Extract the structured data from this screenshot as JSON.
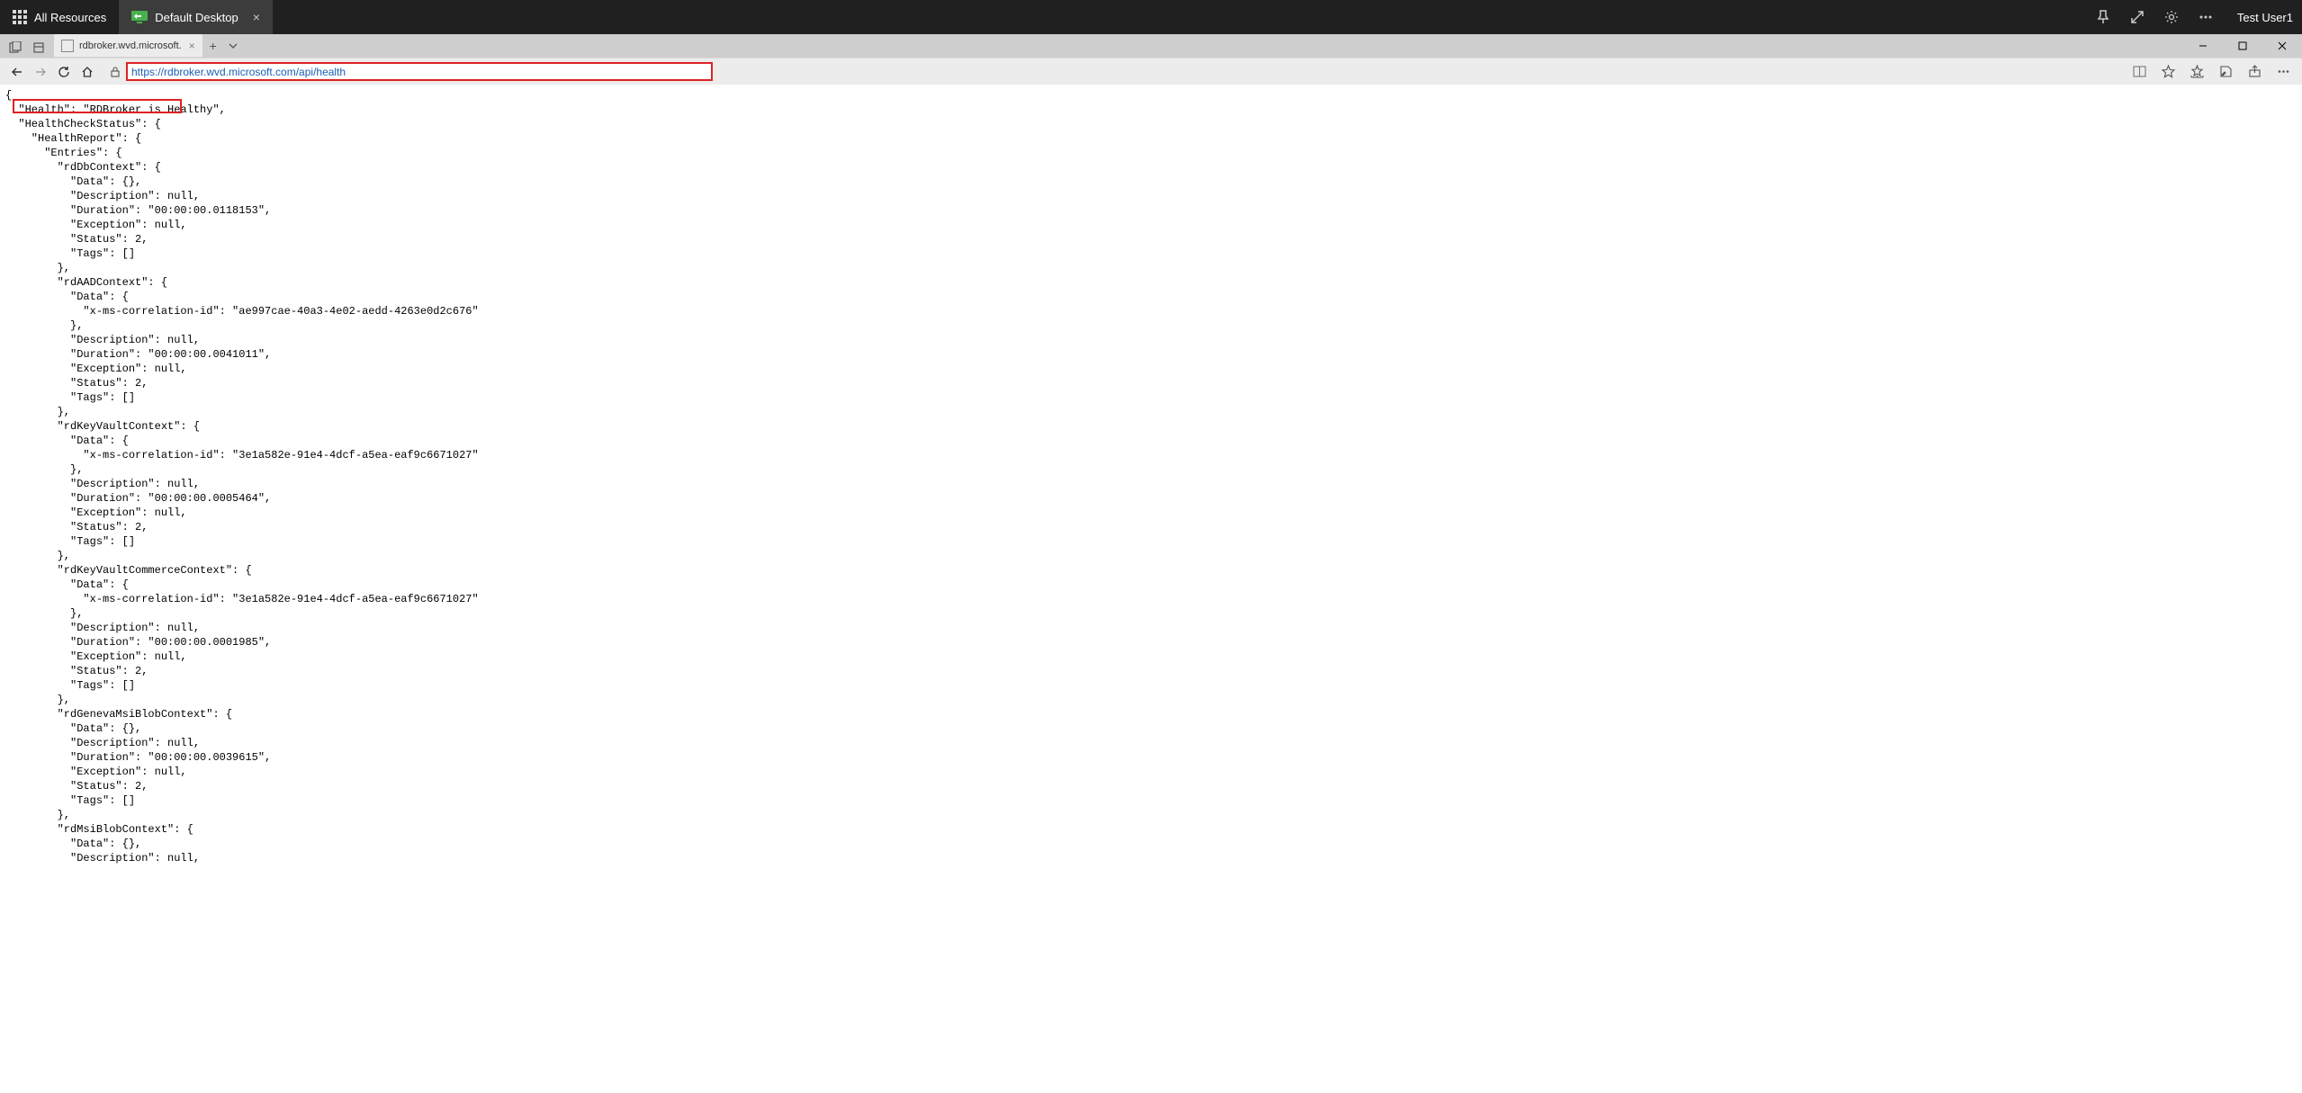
{
  "rd_bar": {
    "tab_all": "All Resources",
    "tab_desktop": "Default Desktop",
    "user": "Test User1"
  },
  "browser": {
    "tab_title": "rdbroker.wvd.microsoft.",
    "url": "https://rdbroker.wvd.microsoft.com/api/health"
  },
  "json_body": "{\n  \"Health\": \"RDBroker is Healthy\",\n  \"HealthCheckStatus\": {\n    \"HealthReport\": {\n      \"Entries\": {\n        \"rdDbContext\": {\n          \"Data\": {},\n          \"Description\": null,\n          \"Duration\": \"00:00:00.0118153\",\n          \"Exception\": null,\n          \"Status\": 2,\n          \"Tags\": []\n        },\n        \"rdAADContext\": {\n          \"Data\": {\n            \"x-ms-correlation-id\": \"ae997cae-40a3-4e02-aedd-4263e0d2c676\"\n          },\n          \"Description\": null,\n          \"Duration\": \"00:00:00.0041011\",\n          \"Exception\": null,\n          \"Status\": 2,\n          \"Tags\": []\n        },\n        \"rdKeyVaultContext\": {\n          \"Data\": {\n            \"x-ms-correlation-id\": \"3e1a582e-91e4-4dcf-a5ea-eaf9c6671027\"\n          },\n          \"Description\": null,\n          \"Duration\": \"00:00:00.0005464\",\n          \"Exception\": null,\n          \"Status\": 2,\n          \"Tags\": []\n        },\n        \"rdKeyVaultCommerceContext\": {\n          \"Data\": {\n            \"x-ms-correlation-id\": \"3e1a582e-91e4-4dcf-a5ea-eaf9c6671027\"\n          },\n          \"Description\": null,\n          \"Duration\": \"00:00:00.0001985\",\n          \"Exception\": null,\n          \"Status\": 2,\n          \"Tags\": []\n        },\n        \"rdGenevaMsiBlobContext\": {\n          \"Data\": {},\n          \"Description\": null,\n          \"Duration\": \"00:00:00.0039615\",\n          \"Exception\": null,\n          \"Status\": 2,\n          \"Tags\": []\n        },\n        \"rdMsiBlobContext\": {\n          \"Data\": {},\n          \"Description\": null,"
}
